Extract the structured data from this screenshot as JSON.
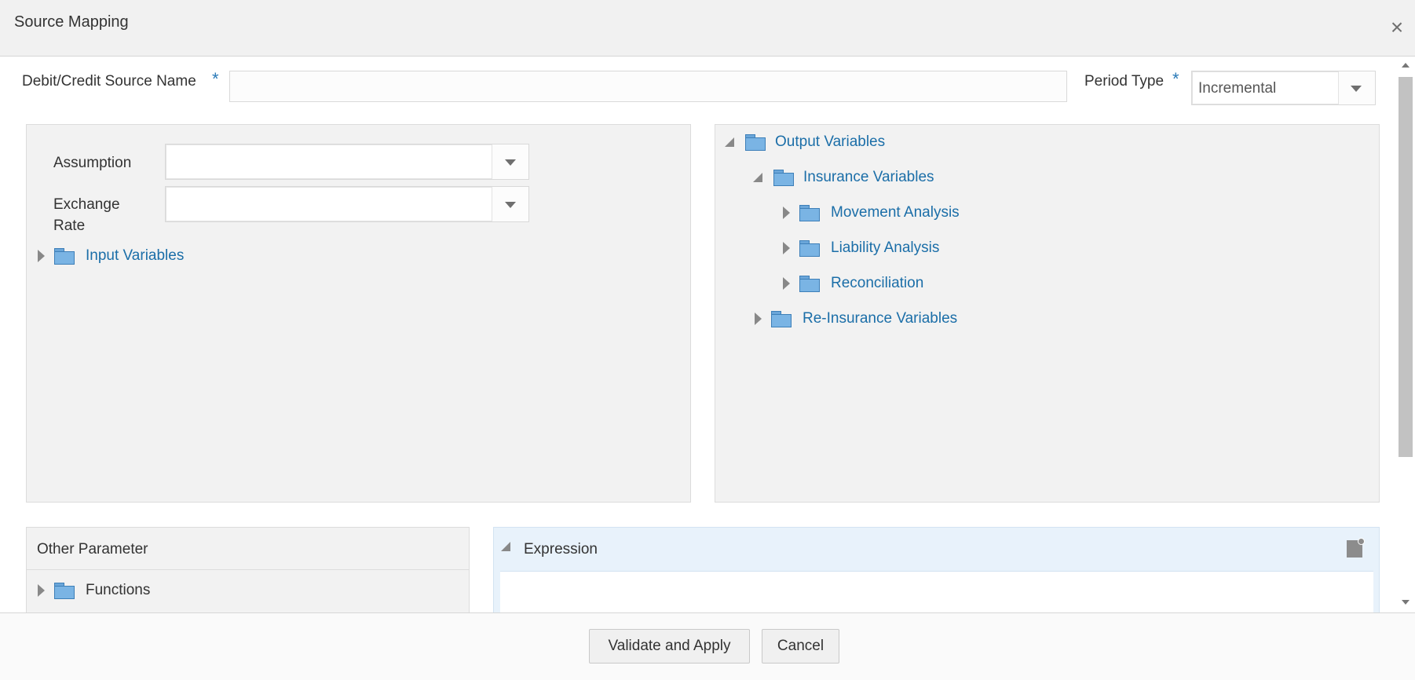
{
  "dialog": {
    "title": "Source Mapping"
  },
  "form": {
    "source_name_label": "Debit/Credit Source Name",
    "source_name_value": "",
    "required_mark": "*",
    "period_type_label": "Period Type",
    "period_type_value": "Incremental"
  },
  "left_panel": {
    "assumption_label": "Assumption",
    "assumption_value": "",
    "exchange_rate_label_line1": "Exchange",
    "exchange_rate_label_line2": "Rate",
    "exchange_rate_value": "",
    "tree": [
      {
        "label": "Input Variables",
        "expanded": false,
        "icon": "folder-icon"
      }
    ]
  },
  "right_panel": {
    "tree": [
      {
        "label": "Output Variables",
        "expanded": true,
        "level": 0
      },
      {
        "label": "Insurance Variables",
        "expanded": true,
        "level": 1
      },
      {
        "label": "Movement Analysis",
        "expanded": false,
        "level": 2
      },
      {
        "label": "Liability Analysis",
        "expanded": false,
        "level": 2
      },
      {
        "label": "Reconciliation",
        "expanded": false,
        "level": 2
      },
      {
        "label": "Re-Insurance Variables",
        "expanded": false,
        "level": 1
      }
    ]
  },
  "other_parameter": {
    "title": "Other Parameter",
    "tree": [
      {
        "label": "Functions",
        "expanded": false
      }
    ]
  },
  "expression": {
    "title": "Expression",
    "value": ""
  },
  "footer": {
    "validate_label": "Validate and Apply",
    "cancel_label": "Cancel"
  },
  "colors": {
    "link": "#1b6ea8",
    "required": "#2a7ab8",
    "folder": "#7ab4e4",
    "expression_header": "#e8f2fb"
  }
}
